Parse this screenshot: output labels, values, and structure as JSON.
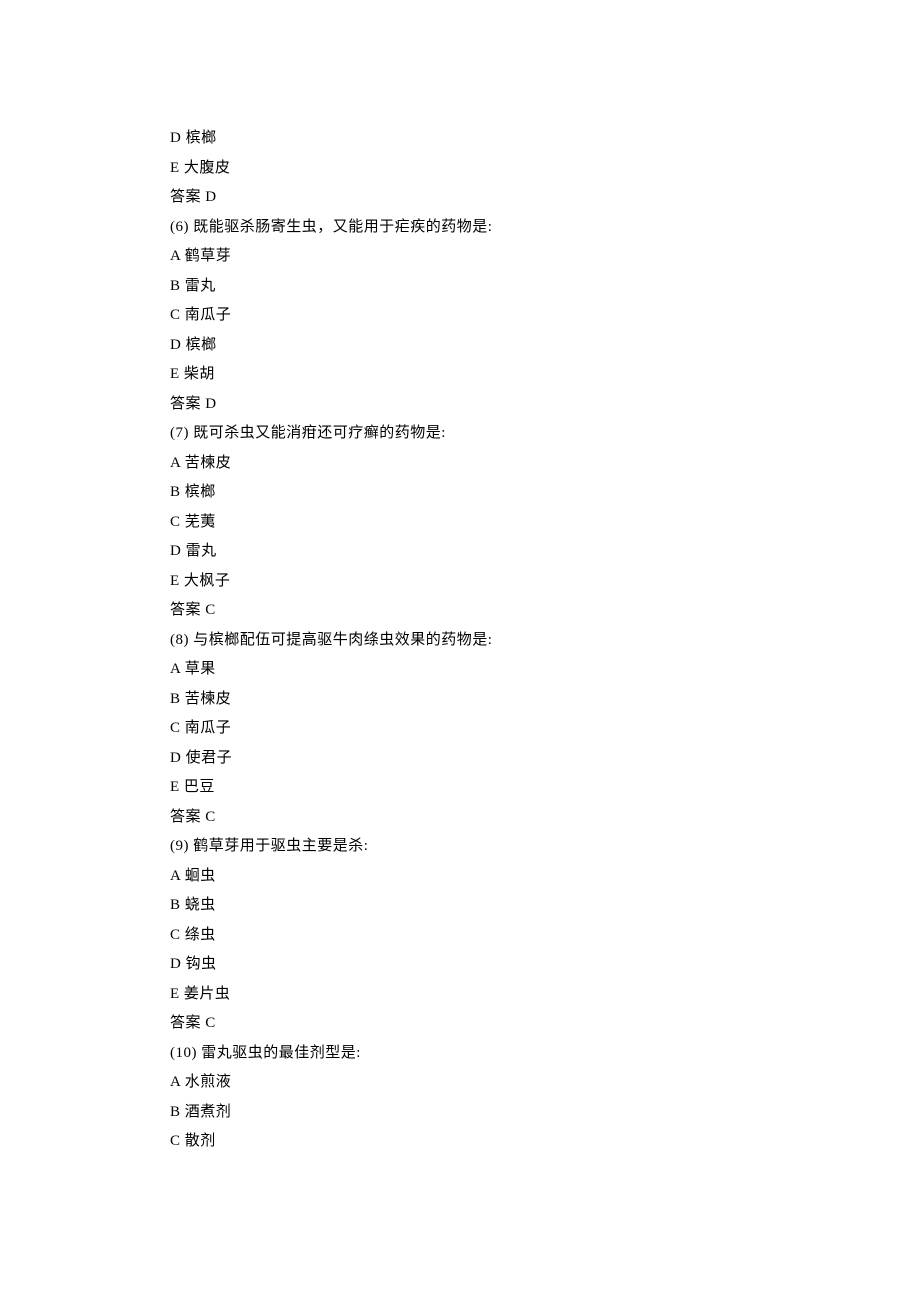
{
  "lines": [
    "D 槟榔",
    "E 大腹皮",
    "答案 D",
    "(6) 既能驱杀肠寄生虫，又能用于疟疾的药物是:",
    "A 鹤草芽",
    "B 雷丸",
    "C 南瓜子",
    "D 槟榔",
    "E 柴胡",
    "答案 D",
    "(7) 既可杀虫又能消疳还可疗癣的药物是:",
    "A 苦楝皮",
    "B 槟榔",
    "C 芜荑",
    "D 雷丸",
    "E 大枫子",
    "答案 C",
    "(8) 与槟榔配伍可提高驱牛肉绦虫效果的药物是:",
    "A 草果",
    "B 苦楝皮",
    "C 南瓜子",
    "D 使君子",
    "E 巴豆",
    "答案 C",
    "(9) 鹤草芽用于驱虫主要是杀:",
    "A 蛔虫",
    "B 蛲虫",
    "C 绦虫",
    "D 钩虫",
    "E 姜片虫",
    "答案 C",
    "(10) 雷丸驱虫的最佳剂型是:",
    "A 水煎液",
    "B 酒煮剂",
    "C 散剂"
  ]
}
